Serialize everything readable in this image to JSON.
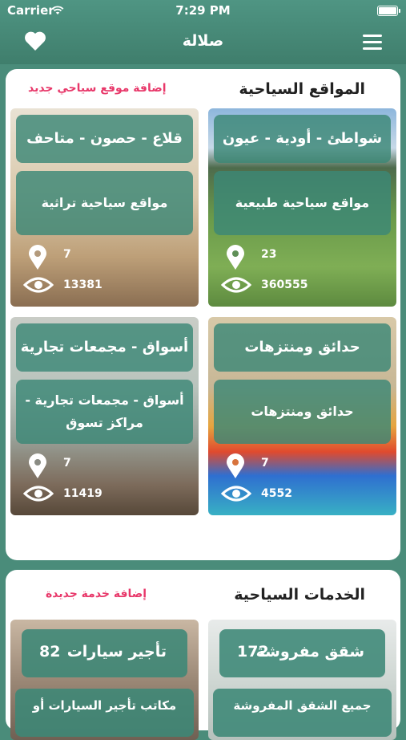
{
  "status": {
    "carrier": "Carrier",
    "time": "7:29 PM"
  },
  "header": {
    "title": "صلالة"
  },
  "tourist_sites": {
    "title": "المواقع السياحية",
    "add_label": "إضافة موقع سياحي جديد",
    "cards": [
      {
        "heading": "شواطئ - أودية - عيون",
        "description": "مواقع سياحية طبيعية",
        "locations": "23",
        "views": "360555"
      },
      {
        "heading": "قلاع - حصون - متاحف",
        "description": "مواقع سياحية تراثية",
        "locations": "7",
        "views": "13381"
      },
      {
        "heading": "حدائق ومنتزهات",
        "description": "حدائق ومنتزهات",
        "locations": "7",
        "views": "4552"
      },
      {
        "heading": "أسواق - مجمعات تجارية",
        "description": "أسواق - مجمعات تجارية - مراكز تسوق",
        "locations": "7",
        "views": "11419"
      }
    ]
  },
  "tourist_services": {
    "title": "الخدمات السياحية",
    "add_label": "إضافة خدمة جديدة",
    "cards": [
      {
        "name": "شقق مفروشة",
        "count": "172",
        "description": "جميع الشقق المفروشة"
      },
      {
        "name": "تأجير سيارات",
        "count": "82",
        "description": "مكاتب تأجير السيارات أو"
      }
    ]
  },
  "colors": {
    "header": "#458a78",
    "accent": "#e8386a",
    "pill": "#3c8776"
  }
}
